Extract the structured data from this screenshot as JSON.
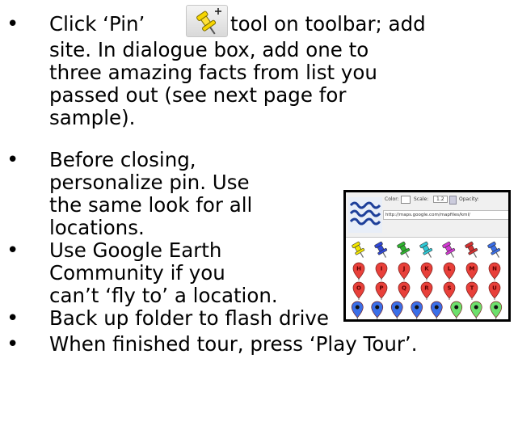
{
  "bullets": [
    {
      "lines": [
        {
          "text": "Click ‘Pin’"
        },
        {
          "text": "tool on toolbar; add"
        },
        {
          "text": "site.  In  dialogue  box,  add  one  to"
        },
        {
          "text": "three  amazing  facts  from  list  you"
        },
        {
          "text": "passed   out   (see   next   page   for"
        },
        {
          "text": "sample)."
        }
      ]
    },
    {
      "lines": [
        {
          "text": "Before        closing,"
        },
        {
          "text": "personalize  pin.  Use"
        },
        {
          "text": "the  same  look  for  all"
        },
        {
          "text": "locations."
        }
      ]
    },
    {
      "lines": [
        {
          "text": "Use      Google      Earth"
        },
        {
          "text": "Community      if      you"
        },
        {
          "text": "can’t ‘fly to’ a location."
        }
      ]
    },
    {
      "lines": [
        {
          "text": "Back up folder to flash drive"
        }
      ]
    },
    {
      "lines": [
        {
          "text": "When finished tour, press ‘Play Tour’."
        }
      ]
    }
  ],
  "pin_tool_icon": "yellow-pushpin-with-plus-icon",
  "inset": {
    "color_label": "Color:",
    "scale_label": "Scale:",
    "scale_value": "1.2",
    "opacity_label": "Opacity:",
    "url": "http://maps.google.com/mapfiles/kml/",
    "pin_rows": [
      {
        "style": "pushpin",
        "colors": [
          "#f2e600",
          "#2f47d8",
          "#2fb52f",
          "#2fc9d6",
          "#d43ad4",
          "#d53030",
          "#3b6fe8"
        ]
      },
      {
        "style": "paddle-letter",
        "letters": [
          "H",
          "I",
          "J",
          "K",
          "L",
          "M",
          "N"
        ],
        "colors": [
          "#e8403a",
          "#e8403a",
          "#e8403a",
          "#e8403a",
          "#e8403a",
          "#e8403a",
          "#e8403a"
        ]
      },
      {
        "style": "paddle-letter",
        "letters": [
          "O",
          "P",
          "Q",
          "R",
          "S",
          "T",
          "U"
        ],
        "colors": [
          "#e8403a",
          "#e8403a",
          "#e8403a",
          "#e8403a",
          "#e8403a",
          "#e8403a",
          "#e8403a"
        ]
      },
      {
        "style": "paddle-dot",
        "colors": [
          "#3b6fe8",
          "#3b6fe8",
          "#3b6fe8",
          "#3b6fe8",
          "#3b6fe8",
          "#6de06d",
          "#6de06d",
          "#6de06d"
        ]
      }
    ]
  }
}
